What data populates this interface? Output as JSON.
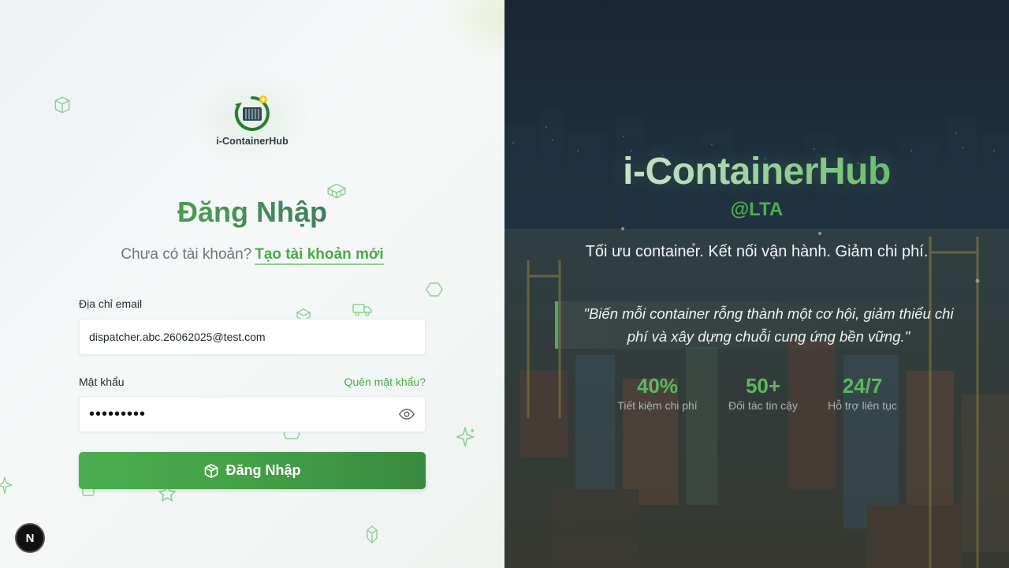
{
  "logo": {
    "text": "i-ContainerHub"
  },
  "login": {
    "title": "Đăng Nhập",
    "no_account_text": "Chưa có tài khoản?",
    "create_account_link": "Tạo tài khoản mới",
    "email_label": "Địa chỉ email",
    "email_value": "dispatcher.abc.26062025@test.com",
    "password_label": "Mật khẩu",
    "forgot_password": "Quên mật khẩu?",
    "password_masked": "•••••••••",
    "submit_label": "Đăng Nhập"
  },
  "dev_badge": {
    "letter": "N"
  },
  "hero": {
    "brand": "i-ContainerHub",
    "brand_sub": "@LTA",
    "tagline": "Tối ưu container. Kết nối vận hành. Giảm chi phí.",
    "quote": "\"Biến mỗi container rỗng thành một cơ hội, giảm thiểu chi phí và xây dựng chuỗi cung ứng bền vững.\"",
    "stats": [
      {
        "value": "40%",
        "label": "Tiết kiệm chi phí"
      },
      {
        "value": "50+",
        "label": "Đối tác tin cậy"
      },
      {
        "value": "24/7",
        "label": "Hỗ trợ liên tục"
      }
    ]
  },
  "colors": {
    "primary_green": "#4caf50",
    "dark_panel": "#1d2d3b"
  }
}
